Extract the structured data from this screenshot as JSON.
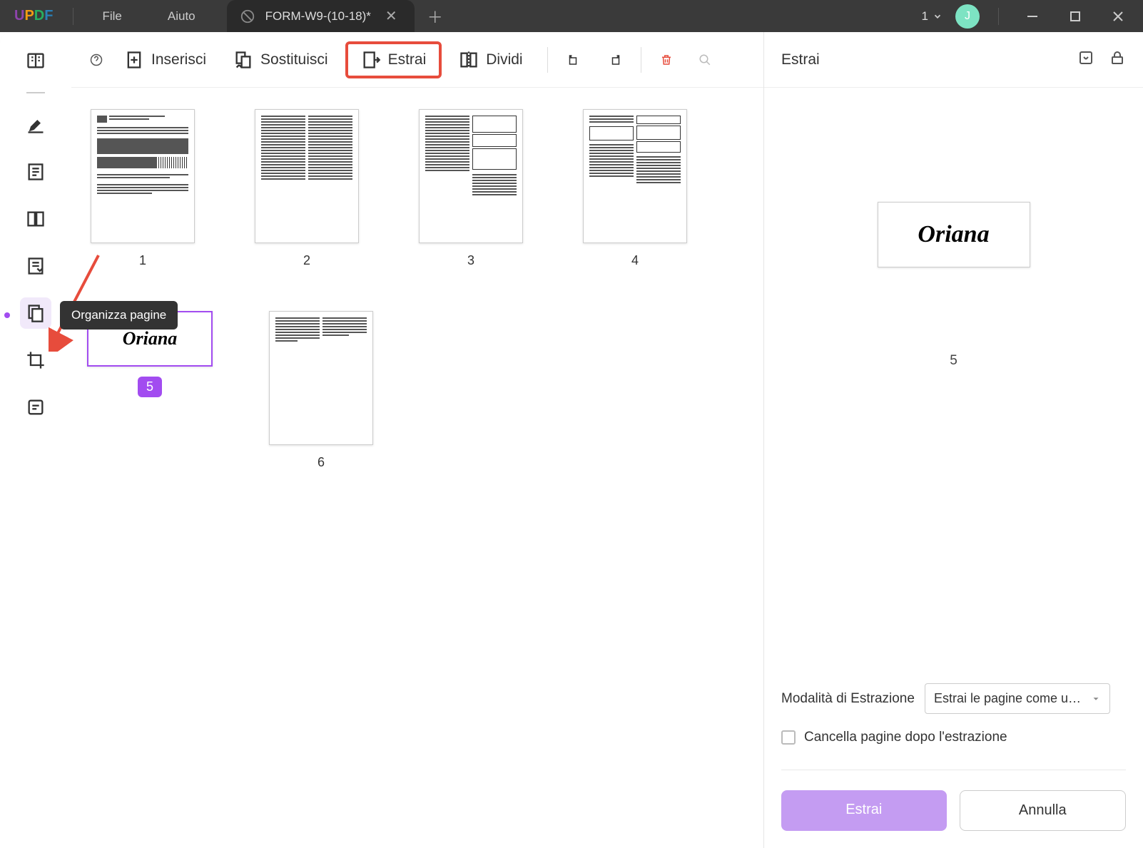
{
  "titlebar": {
    "menu_file": "File",
    "menu_help": "Aiuto",
    "tab_name": "FORM-W9-(10-18)*",
    "count": "1",
    "avatar": "J"
  },
  "sidebar": {
    "tooltip": "Organizza pagine"
  },
  "toolbar": {
    "insert": "Inserisci",
    "replace": "Sostituisci",
    "extract": "Estrai",
    "split": "Dividi"
  },
  "thumbs": {
    "p1": "1",
    "p2": "2",
    "p3": "3",
    "p4": "4",
    "p5": "5",
    "p6": "6",
    "oriana": "Oriana"
  },
  "right": {
    "title": "Estrai",
    "preview_text": "Oriana",
    "preview_num": "5",
    "mode_label": "Modalità di Estrazione",
    "mode_value": "Estrai le pagine come un uni…",
    "delete_after": "Cancella pagine dopo l'estrazione",
    "btn_extract": "Estrai",
    "btn_cancel": "Annulla"
  }
}
